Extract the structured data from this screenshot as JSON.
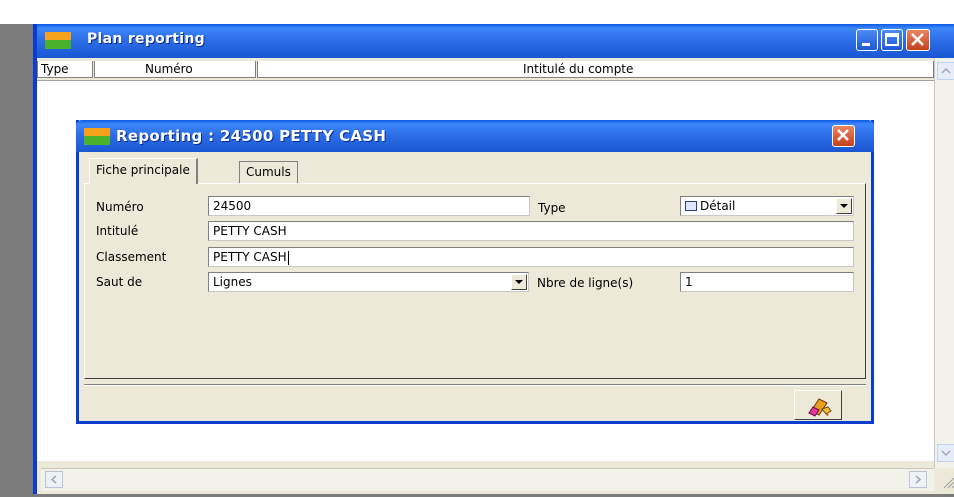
{
  "outer_window": {
    "title": "Plan reporting",
    "columns": [
      "Type",
      "Numéro",
      "Intitulé du compte"
    ]
  },
  "dialog": {
    "title": "Reporting : 24500 PETTY CASH",
    "tabs": [
      {
        "label": "Fiche principale",
        "active": true
      },
      {
        "label": "Cumuls",
        "active": false
      }
    ],
    "fields": {
      "numero_label": "Numéro",
      "numero_value": "24500",
      "type_label": "Type",
      "type_value": "Détail",
      "intitule_label": "Intitulé",
      "intitule_value": "PETTY CASH",
      "classement_label": "Classement",
      "classement_value": "PETTY CASH",
      "saut_label": "Saut de",
      "saut_value": "Lignes",
      "nbre_label": "Nbre de ligne(s)",
      "nbre_value": "1"
    }
  },
  "colors": {
    "titlebar_blue": "#2d6fe8",
    "dialog_bg": "#ece9d8",
    "close_red": "#d4532b"
  }
}
